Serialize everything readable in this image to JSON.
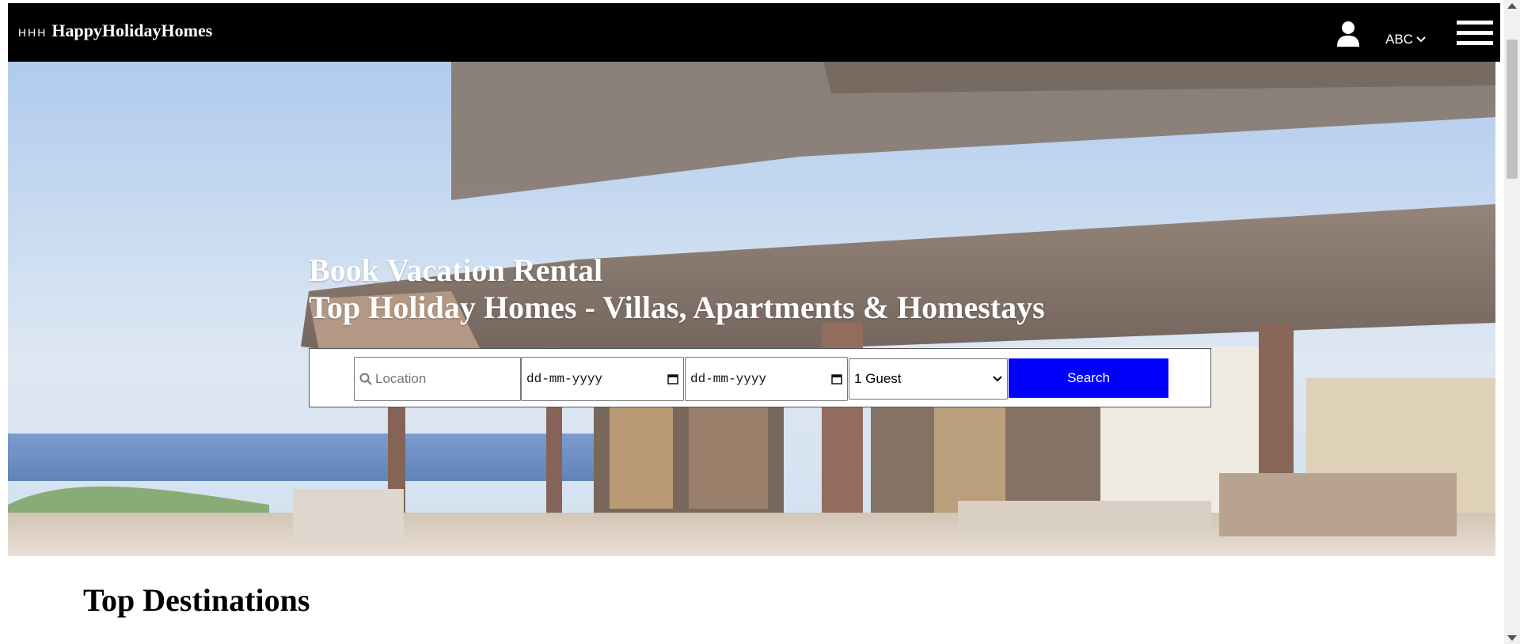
{
  "header": {
    "logo_mark": "HHH",
    "logo_name": "HappyHolidayHomes",
    "language": "ABC",
    "icons": [
      "user-icon",
      "chevron-down-icon",
      "hamburger-menu-icon"
    ]
  },
  "hero": {
    "headline_line1": "Book Vacation Rental",
    "headline_line2": "Top Holiday Homes - Villas, Apartments & Homestays"
  },
  "search": {
    "location_placeholder": "Location",
    "checkin_placeholder": "dd-mm-yyyy",
    "checkout_placeholder": "dd-mm-yyyy",
    "guests_selected": "1 Guest",
    "button_label": "Search",
    "button_color": "#0000ff"
  },
  "sections": {
    "top_destinations_title": "Top Destinations"
  }
}
